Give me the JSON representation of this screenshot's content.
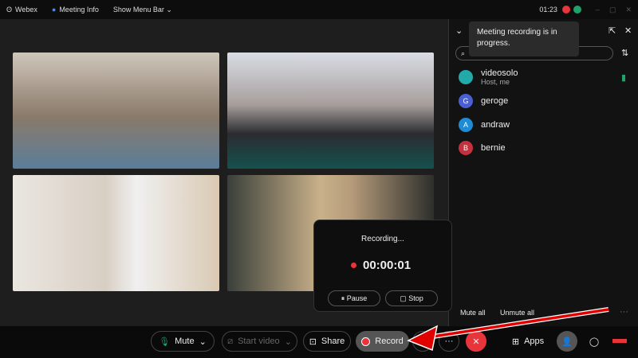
{
  "topbar": {
    "app": "Webex",
    "meeting_info": "Meeting Info",
    "show_menu_bar": "Show Menu Bar",
    "time": "01:23"
  },
  "participants": [
    {
      "name": "videosolo",
      "role": "Host, me",
      "color": "#2aa"
    },
    {
      "name": "geroge",
      "initial": "G",
      "color": "#4a5fd1"
    },
    {
      "name": "andraw",
      "initial": "A",
      "color": "#1e8bd6"
    },
    {
      "name": "bernie",
      "initial": "B",
      "color": "#c2313d"
    }
  ],
  "tooltip": "Meeting recording is in progress.",
  "recording": {
    "title": "Recording...",
    "timer": "00:00:01",
    "pause": "Pause",
    "stop": "Stop"
  },
  "panel": {
    "mute_all": "Mute all",
    "unmute_all": "Unmute all"
  },
  "controls": {
    "mute": "Mute",
    "start_video": "Start video",
    "share": "Share",
    "record": "Record",
    "apps": "Apps"
  },
  "colors": {
    "record_red": "#e8353b",
    "annotation_arrow": "#e00000"
  }
}
